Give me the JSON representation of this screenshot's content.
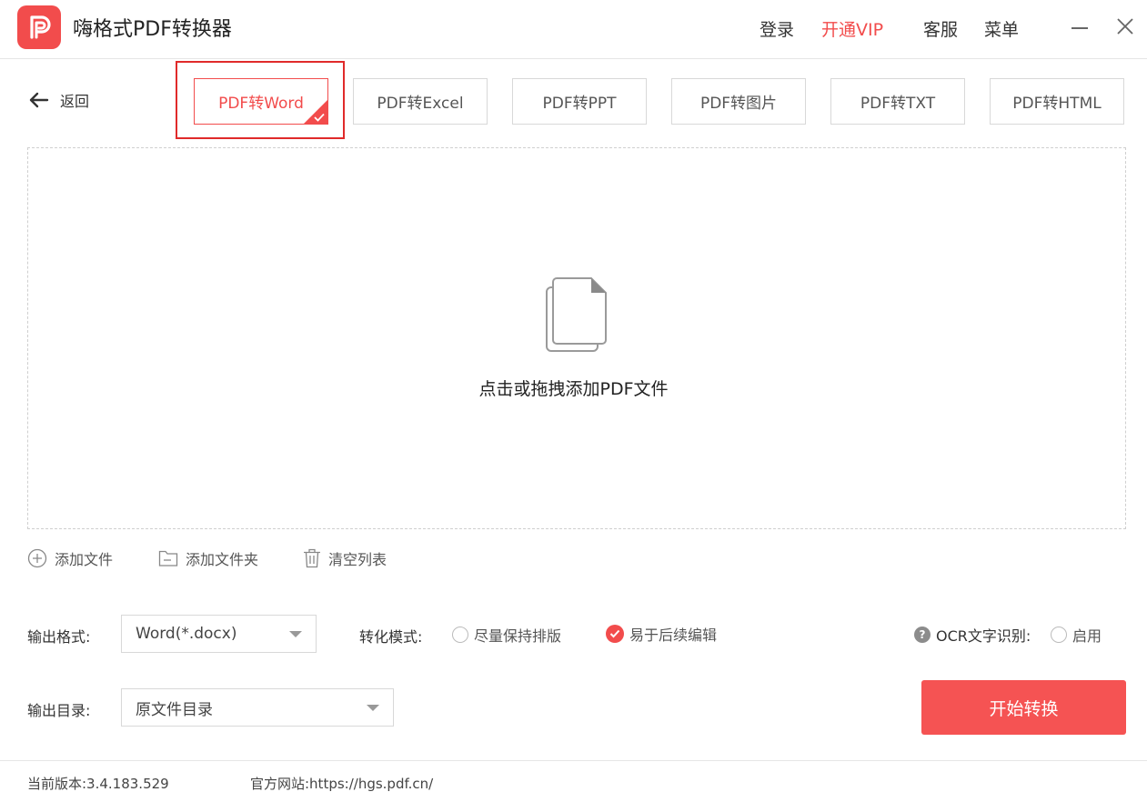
{
  "app": {
    "title": "嗨格式PDF转换器"
  },
  "header": {
    "login": "登录",
    "vip": "开通VIP",
    "service": "客服",
    "menu": "菜单"
  },
  "nav": {
    "back_label": "返回"
  },
  "tabs": [
    {
      "label": "PDF转Word",
      "active": true
    },
    {
      "label": "PDF转Excel",
      "active": false
    },
    {
      "label": "PDF转PPT",
      "active": false
    },
    {
      "label": "PDF转图片",
      "active": false
    },
    {
      "label": "PDF转TXT",
      "active": false
    },
    {
      "label": "PDF转HTML",
      "active": false
    }
  ],
  "dropzone": {
    "text": "点击或拖拽添加PDF文件"
  },
  "file_actions": {
    "add_file": "添加文件",
    "add_folder": "添加文件夹",
    "clear_list": "清空列表"
  },
  "settings": {
    "output_format_label": "输出格式:",
    "output_format_value": "Word(*.docx)",
    "mode_label": "转化模式:",
    "mode_option_1": "尽量保持排版",
    "mode_option_2": "易于后续编辑",
    "ocr_label": "OCR文字识别:",
    "ocr_option": "启用",
    "output_dir_label": "输出目录:",
    "output_dir_value": "原文件目录",
    "start_button": "开始转换"
  },
  "footer": {
    "version": "当前版本:3.4.183.529",
    "website": "官方网站:https://hgs.pdf.cn/"
  },
  "colors": {
    "accent": "#f24c4c",
    "highlight_box": "#e02a2a"
  }
}
